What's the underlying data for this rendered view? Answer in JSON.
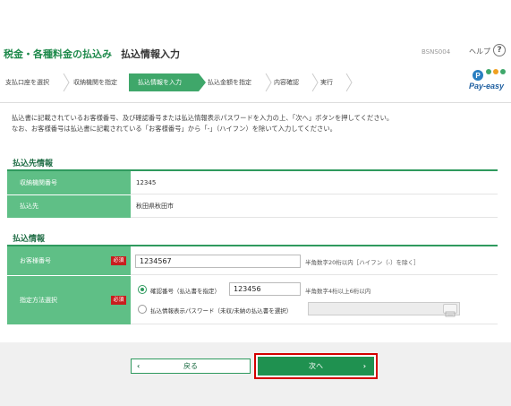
{
  "header": {
    "title": "税金・各種料金の払込み",
    "subtitle": "払込情報入力",
    "screen_code": "BSNS004",
    "help_label": "ヘルプ",
    "help_icon": "?"
  },
  "steps": [
    {
      "label": "支払口座を選択",
      "active": false
    },
    {
      "label": "収納機関を指定",
      "active": false
    },
    {
      "label": "払込情報を入力",
      "active": true
    },
    {
      "label": "払込金額を指定",
      "active": false
    },
    {
      "label": "内容確認",
      "active": false
    },
    {
      "label": "実行",
      "active": false
    }
  ],
  "logo": {
    "text": "Pay-easy",
    "icon": "pay-easy-logo"
  },
  "notice": {
    "line1": "払込書に記載されているお客様番号、及び確認番号または払込情報表示パスワードを入力の上、「次へ」ボタンを押してください。",
    "line2": "なお、お客様番号は払込書に記載されている「お客様番号」から「-」（ハイフン）を除いて入力してください。"
  },
  "payee_section": {
    "title": "払込先情報",
    "rows": [
      {
        "label": "収納機関番号",
        "value": "12345"
      },
      {
        "label": "払込先",
        "value": "秋田県秋田市"
      }
    ]
  },
  "payment_section": {
    "title": "払込情報",
    "customer_number": {
      "label": "お客様番号",
      "required": "必須",
      "value": "1234567",
      "hint": "半角数字20桁以内［ハイフン（-）を除く］"
    },
    "method": {
      "label": "指定方法選択",
      "required": "必須",
      "option1_label": "確認番号（払込書を指定）",
      "option1_value": "123456",
      "option1_hint": "半角数字4桁以上6桁以内",
      "option2_label": "払込情報表示パスワード（未収/未納の払込書を選択）",
      "option2_value": "",
      "selected": "option1"
    }
  },
  "buttons": {
    "back": "戻る",
    "next": "次へ",
    "back_icon": "‹",
    "next_icon": "›"
  },
  "colors": {
    "brand_green": "#1f8a4c",
    "label_green": "#5fbf86",
    "step_active": "#3fa76a",
    "required_red": "#c81e1e",
    "highlight_red": "#d40000"
  }
}
